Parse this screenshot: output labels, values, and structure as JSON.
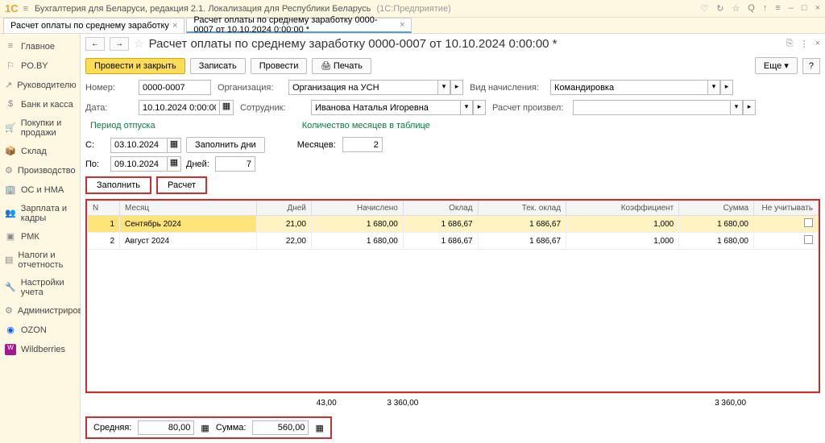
{
  "app": {
    "title": "Бухгалтерия для Беларуси, редакция 2.1. Локализация для Республики Беларусь",
    "sub": "(1С:Предприятие)"
  },
  "tabs": {
    "t1": "Расчет оплаты по среднему заработку",
    "t2": "Расчет оплаты по среднему заработку 0000-0007 от 10.10.2024 0:00:00 *"
  },
  "sidebar": {
    "main": "Главное",
    "poby": "PO.BY",
    "ruk": "Руководителю",
    "bank": "Банк и касса",
    "pokup": "Покупки и продажи",
    "sklad": "Склад",
    "proizv": "Производство",
    "os": "ОС и НМА",
    "zarplata": "Зарплата и кадры",
    "rmk": "РМК",
    "nalogi": "Налоги и отчетность",
    "nastr": "Настройки учета",
    "admin": "Администрирование",
    "ozon": "OZON",
    "wb": "Wildberries"
  },
  "doc": {
    "title": "Расчет оплаты по среднему заработку 0000-0007 от 10.10.2024 0:00:00 *"
  },
  "toolbar": {
    "post_close": "Провести и закрыть",
    "save": "Записать",
    "post": "Провести",
    "print": "Печать",
    "more": "Еще"
  },
  "form": {
    "number_lbl": "Номер:",
    "number": "0000-0007",
    "org_lbl": "Организация:",
    "org": "Организация на УСН",
    "vid_lbl": "Вид начисления:",
    "vid": "Командировка",
    "date_lbl": "Дата:",
    "date": "10.10.2024 0:00:00",
    "sotr_lbl": "Сотрудник:",
    "sotr": "Иванова Наталья Игоревна",
    "rasch_lbl": "Расчет произвел:",
    "rasch": ""
  },
  "period": {
    "title": "Период отпуска",
    "from_lbl": "С:",
    "from": "03.10.2024",
    "to_lbl": "По:",
    "to": "09.10.2024",
    "fill_days": "Заполнить дни",
    "days_lbl": "Дней:",
    "days": "7"
  },
  "months": {
    "title": "Количество месяцев в таблице",
    "lbl": "Месяцев:",
    "val": "2"
  },
  "actions": {
    "fill": "Заполнить",
    "calc": "Расчет"
  },
  "table": {
    "h_n": "N",
    "h_month": "Месяц",
    "h_days": "Дней",
    "h_nach": "Начислено",
    "h_oklad": "Оклад",
    "h_tek": "Тек. оклад",
    "h_koef": "Коэффициент",
    "h_sum": "Сумма",
    "h_neuch": "Не учитывать",
    "rows": [
      {
        "n": "1",
        "month": "Сентябрь 2024",
        "days": "21,00",
        "nach": "1 680,00",
        "oklad": "1 686,67",
        "tek": "1 686,67",
        "koef": "1,000",
        "sum": "1 680,00"
      },
      {
        "n": "2",
        "month": "Август 2024",
        "days": "22,00",
        "nach": "1 680,00",
        "oklad": "1 686,67",
        "tek": "1 686,67",
        "koef": "1,000",
        "sum": "1 680,00"
      }
    ],
    "tot_days": "43,00",
    "tot_nach": "3 360,00",
    "tot_sum": "3 360,00"
  },
  "footer": {
    "avg_lbl": "Средняя:",
    "avg": "80,00",
    "sum_lbl": "Сумма:",
    "sum": "560,00"
  }
}
